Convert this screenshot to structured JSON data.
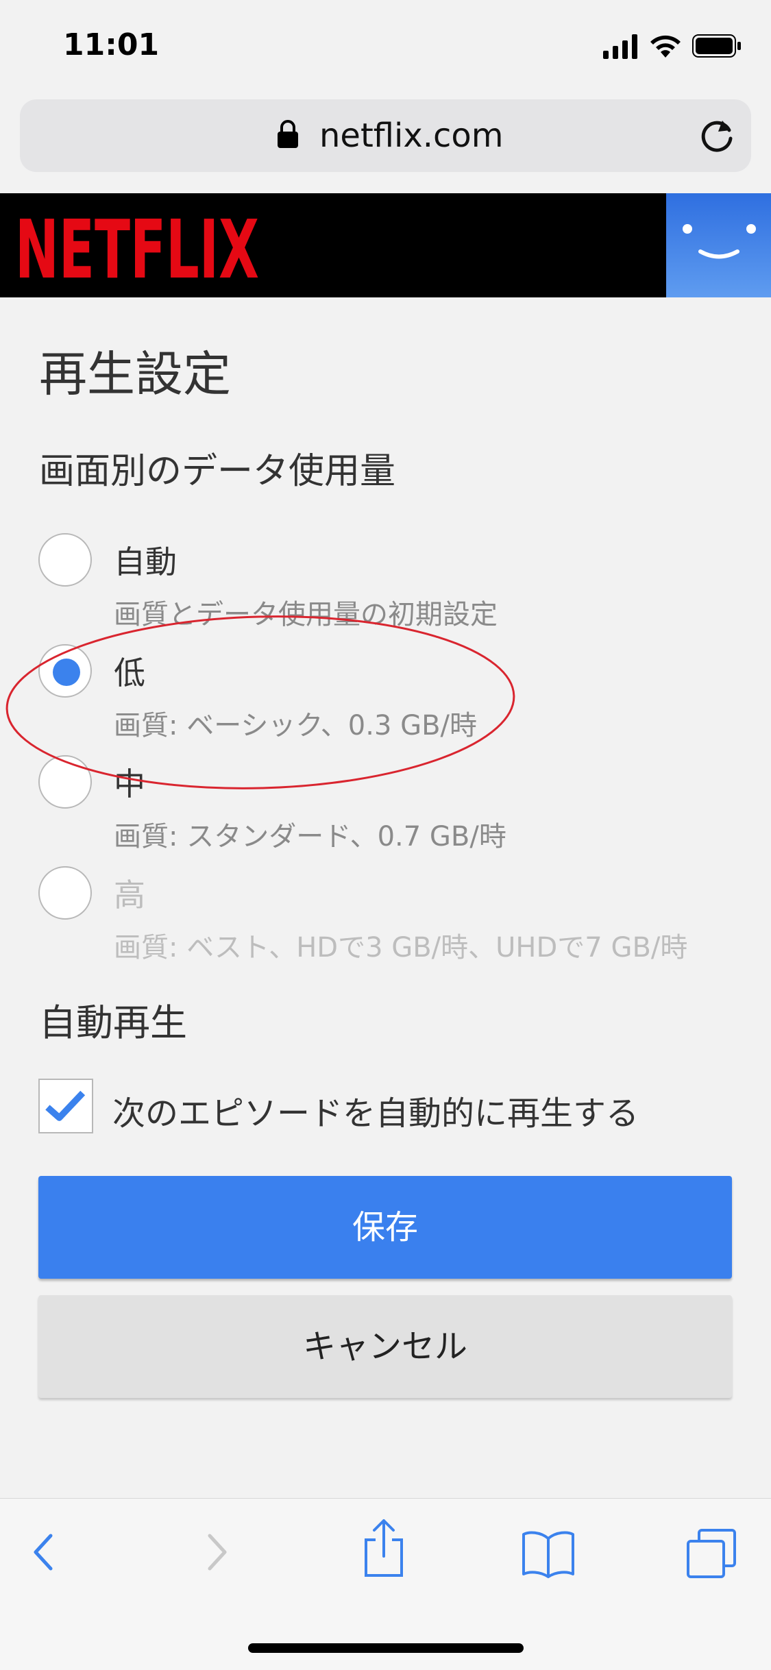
{
  "status_bar": {
    "time": "11:01"
  },
  "browser": {
    "url": "netflix.com"
  },
  "header": {
    "logo_text": "NETFLIX"
  },
  "page": {
    "title": "再生設定",
    "data_usage_heading": "画面別のデータ使用量",
    "options": [
      {
        "label": "自動",
        "description": "画質とデータ使用量の初期設定",
        "selected": false,
        "disabled": false
      },
      {
        "label": "低",
        "description": "画質: ベーシック、0.3 GB/時",
        "selected": true,
        "disabled": false
      },
      {
        "label": "中",
        "description": "画質: スタンダード、0.7 GB/時",
        "selected": false,
        "disabled": false
      },
      {
        "label": "高",
        "description": "画質: ベスト、HDで3 GB/時、UHDで7 GB/時",
        "selected": false,
        "disabled": true
      }
    ],
    "autoplay_heading": "自動再生",
    "autoplay_label": "次のエピソードを自動的に再生する",
    "autoplay_checked": true,
    "save_label": "保存",
    "cancel_label": "キャンセル"
  },
  "colors": {
    "accent": "#3b82ed",
    "netflix_red": "#e50914",
    "annotation": "#d9252f"
  },
  "toolbar": {
    "icons": [
      "back-icon",
      "forward-icon",
      "share-icon",
      "bookmarks-icon",
      "tabs-icon"
    ]
  }
}
